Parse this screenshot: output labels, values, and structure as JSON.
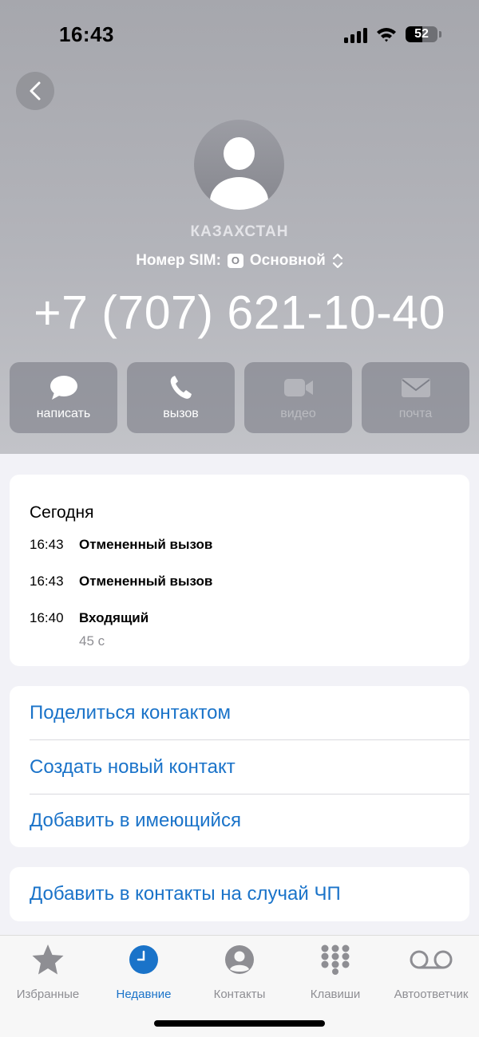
{
  "status_bar": {
    "time": "16:43",
    "battery": "52",
    "battery_level": 0.52
  },
  "contact": {
    "country": "КАЗАХСТАН",
    "sim_label": "Номер SIM:",
    "sim_badge": "O",
    "sim_name": "Основной",
    "phone": "+7 (707) 621-10-40"
  },
  "actions": [
    {
      "label": "написать",
      "icon": "message-bubble-icon",
      "enabled": true
    },
    {
      "label": "вызов",
      "icon": "phone-icon",
      "enabled": true
    },
    {
      "label": "видео",
      "icon": "video-camera-icon",
      "enabled": false
    },
    {
      "label": "почта",
      "icon": "envelope-icon",
      "enabled": false
    }
  ],
  "history": {
    "title": "Сегодня",
    "records": [
      {
        "time": "16:43",
        "kind": "Отмененный вызов"
      },
      {
        "time": "16:43",
        "kind": "Отмененный вызов"
      },
      {
        "time": "16:40",
        "kind": "Входящий",
        "duration": "45 с"
      }
    ]
  },
  "links": {
    "share": "Поделиться контактом",
    "create": "Создать новый контакт",
    "add_existing": "Добавить в имеющийся",
    "emergency": "Добавить в контакты на случай ЧП"
  },
  "tabs": [
    {
      "label": "Избранные",
      "icon": "star-icon",
      "active": false
    },
    {
      "label": "Недавние",
      "icon": "clock-icon",
      "active": true
    },
    {
      "label": "Контакты",
      "icon": "person-circle-icon",
      "active": false
    },
    {
      "label": "Клавиши",
      "icon": "keypad-icon",
      "active": false
    },
    {
      "label": "Автоответчик",
      "icon": "voicemail-icon",
      "active": false
    }
  ],
  "colors": {
    "accent": "#1a73c9",
    "header_bg": "#adaeb4",
    "secondary_text": "#8e8e93"
  }
}
